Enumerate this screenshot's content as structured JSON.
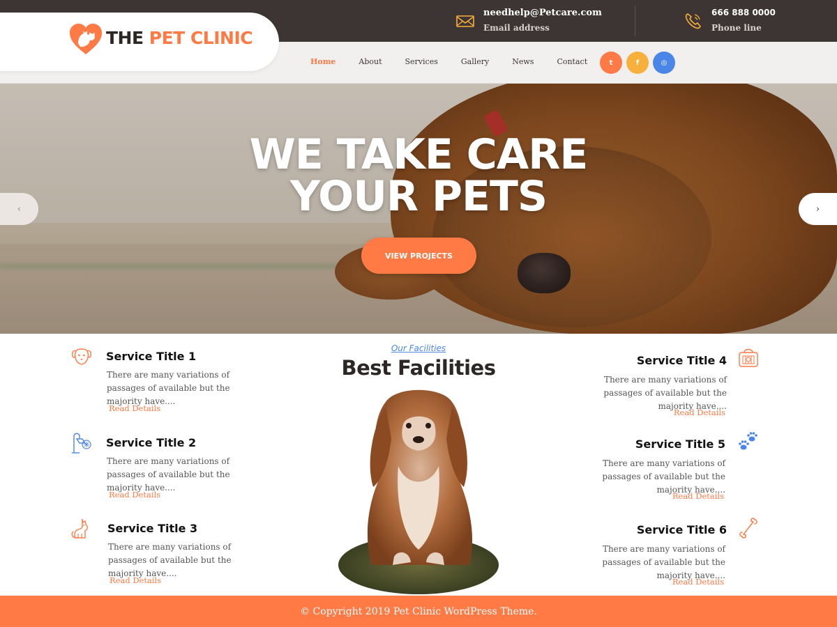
{
  "brand": {
    "prefix": "THE",
    "name": "PET CLINIC",
    "accent": "#ff7a45",
    "dark": "#3d3533"
  },
  "contact": {
    "email": {
      "value": "needhelp@Petcare.com",
      "label": "Email address",
      "icon": "envelope-icon"
    },
    "phone": {
      "value": "666 888 0000",
      "label": "Phone line",
      "icon": "phone-icon"
    }
  },
  "nav": {
    "items": [
      {
        "label": "Home",
        "active": true
      },
      {
        "label": "About"
      },
      {
        "label": "Services"
      },
      {
        "label": "Gallery"
      },
      {
        "label": "News"
      },
      {
        "label": "Contact"
      }
    ]
  },
  "socials": [
    {
      "label": "t",
      "icon": "twitter-icon",
      "color": "#ff7a45"
    },
    {
      "label": "f",
      "icon": "facebook-icon",
      "color": "#f7b03c"
    },
    {
      "label": "◎",
      "icon": "instagram-icon",
      "color": "#4a86e8"
    }
  ],
  "hero": {
    "title_line1": "WE TAKE CARE",
    "title_line2": "YOUR PETS",
    "button": "VIEW PROJECTS",
    "prev": "‹",
    "next": "›"
  },
  "facilities": {
    "label": "Our Facilities",
    "title": "Best Facilities"
  },
  "services": [
    {
      "title": "Service Title 1",
      "desc": "There are many variations of passages of available but the majority have....",
      "link": "Read Details",
      "icon": "dog-face-icon"
    },
    {
      "title": "Service Title 2",
      "desc": "There are many variations of passages of available but the majority have....",
      "link": "Read Details",
      "icon": "shower-icon"
    },
    {
      "title": "Service Title 3",
      "desc": "There are many variations of passages of available but the majority have....",
      "link": "Read Details",
      "icon": "cat-icon"
    },
    {
      "title": "Service Title 4",
      "desc": "There are many variations of passages of available but the majority have....",
      "link": "Read Details",
      "icon": "pet-carrier-icon"
    },
    {
      "title": "Service Title 5",
      "desc": "There are many variations of passages of available but the majority have....",
      "link": "Read Details",
      "icon": "paw-prints-icon"
    },
    {
      "title": "Service Title 6",
      "desc": "There are many variations of passages of available but the majority have....",
      "link": "Read Details",
      "icon": "bone-icon"
    }
  ],
  "footer": {
    "copyright": "© Copyright 2019 Pet Clinic WordPress Theme."
  }
}
